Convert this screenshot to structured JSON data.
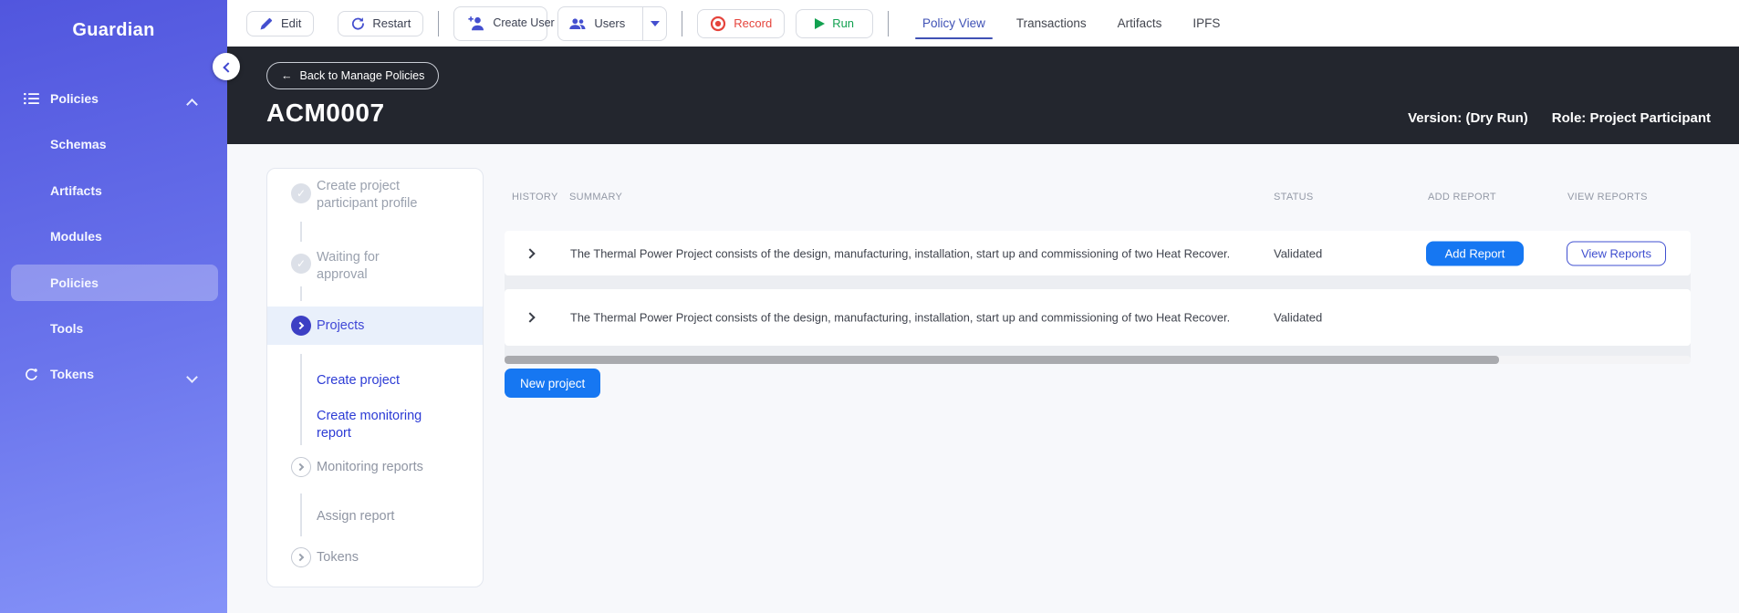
{
  "sidebar": {
    "logo": "Guardian",
    "items": [
      {
        "label": "Policies"
      },
      {
        "label": "Schemas"
      },
      {
        "label": "Artifacts"
      },
      {
        "label": "Modules"
      },
      {
        "label": "Policies"
      },
      {
        "label": "Tools"
      },
      {
        "label": "Tokens"
      }
    ]
  },
  "toolbar": {
    "edit_label": "Edit",
    "restart_label": "Restart",
    "create_user_label": "Create User",
    "users_label": "Users",
    "record_label": "Record",
    "run_label": "Run",
    "tabs": [
      {
        "label": "Policy View"
      },
      {
        "label": "Transactions"
      },
      {
        "label": "Artifacts"
      },
      {
        "label": "IPFS"
      }
    ]
  },
  "header": {
    "back_label": "Back to Manage Policies",
    "back_arrow": "←",
    "title": "ACM0007",
    "version": "Version: (Dry Run)",
    "role": "Role: Project Participant"
  },
  "stepper": {
    "steps": [
      {
        "label": "Create project participant profile",
        "state": "done"
      },
      {
        "label": "Waiting for approval",
        "state": "done"
      },
      {
        "label": "Projects",
        "state": "active"
      },
      {
        "label": "Create project",
        "state": "link"
      },
      {
        "label": "Create monitoring report",
        "state": "link"
      },
      {
        "label": "Monitoring reports",
        "state": "pending"
      },
      {
        "label": "Assign report",
        "state": "plain"
      },
      {
        "label": "Tokens",
        "state": "pending"
      }
    ],
    "check_glyph": "✓"
  },
  "table": {
    "columns": [
      "HISTORY",
      "SUMMARY",
      "STATUS",
      "ADD REPORT",
      "VIEW REPORTS"
    ],
    "rows": [
      {
        "summary": "The Thermal Power Project consists of the design, manufacturing, installation, start up and commissioning of two Heat Recover.",
        "status": "Validated",
        "add_report_label": "Add Report",
        "view_reports_label": "View Reports"
      },
      {
        "summary": "The Thermal Power Project consists of the design, manufacturing, installation, start up and commissioning of two Heat Recover.",
        "status": "Validated"
      }
    ],
    "new_project_label": "New project"
  },
  "colors": {
    "accent_blue": "#1677f2",
    "indigo": "#3f4bd8",
    "record_red": "#e5443c",
    "run_green": "#12a150",
    "header_bg": "#23262e",
    "sidebar_top": "#5156de",
    "sidebar_bottom": "#8593f8"
  }
}
